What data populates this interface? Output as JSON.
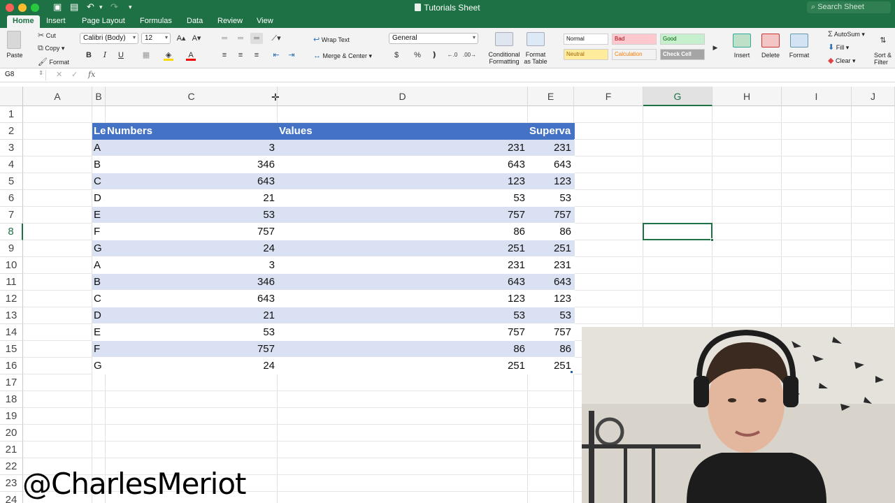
{
  "window": {
    "title": "Tutorials Sheet",
    "search_placeholder": "Search Sheet"
  },
  "ribbon_tabs": [
    {
      "label": "Home",
      "active": true
    },
    {
      "label": "Insert"
    },
    {
      "label": "Page Layout"
    },
    {
      "label": "Formulas"
    },
    {
      "label": "Data"
    },
    {
      "label": "Review"
    },
    {
      "label": "View"
    }
  ],
  "ribbon": {
    "paste": "Paste",
    "cut": "Cut",
    "copy": "Copy",
    "format": "Format",
    "font_name": "Calibri (Body)",
    "font_size": "12",
    "bold": "B",
    "italic": "I",
    "underline": "U",
    "wrap_text": "Wrap Text",
    "merge_center": "Merge & Center",
    "number_format": "General",
    "currency": "$",
    "percent": "%",
    "conditional_formatting": [
      "Conditional",
      "Formatting"
    ],
    "format_as_table": [
      "Format",
      "as Table"
    ],
    "styles": [
      {
        "label": "Normal",
        "bg": "#ffffff",
        "fg": "#111111"
      },
      {
        "label": "Bad",
        "bg": "#ffc7ce",
        "fg": "#9c0006"
      },
      {
        "label": "Good",
        "bg": "#c6efce",
        "fg": "#006100"
      },
      {
        "label": "Neutral",
        "bg": "#ffeb9c",
        "fg": "#9c6500"
      },
      {
        "label": "Calculation",
        "bg": "#f2f2f2",
        "fg": "#fa7d00"
      },
      {
        "label": "Check Cell",
        "bg": "#a5a5a5",
        "fg": "#ffffff"
      }
    ],
    "insert": "Insert",
    "delete": "Delete",
    "format_cells": "Format",
    "autosum": "AutoSum",
    "fill": "Fill",
    "clear": "Clear",
    "sort_filter": [
      "Sort &",
      "Filter"
    ]
  },
  "formula_bar": {
    "name_box": "G8",
    "fx": "fx"
  },
  "sheet": {
    "columns": [
      "A",
      "B",
      "C",
      "D",
      "E",
      "F",
      "G",
      "H",
      "I",
      "J"
    ],
    "selected_column": "G",
    "rows": [
      "1",
      "2",
      "3",
      "4",
      "5",
      "6",
      "7",
      "8",
      "9",
      "10",
      "11",
      "12",
      "13",
      "14",
      "15",
      "16",
      "17",
      "18",
      "19",
      "20",
      "21",
      "22",
      "23",
      "24"
    ],
    "selected_row": "8",
    "table_headers": [
      "Le",
      "Numbers",
      "Values",
      "Superva"
    ],
    "table_rows": [
      [
        "A",
        "3",
        "231",
        "231"
      ],
      [
        "B",
        "346",
        "643",
        "643"
      ],
      [
        "C",
        "643",
        "123",
        "123"
      ],
      [
        "D",
        "21",
        "53",
        "53"
      ],
      [
        "E",
        "53",
        "757",
        "757"
      ],
      [
        "F",
        "757",
        "86",
        "86"
      ],
      [
        "G",
        "24",
        "251",
        "251"
      ],
      [
        "A",
        "3",
        "231",
        "231"
      ],
      [
        "B",
        "346",
        "643",
        "643"
      ],
      [
        "C",
        "643",
        "123",
        "123"
      ],
      [
        "D",
        "21",
        "53",
        "53"
      ],
      [
        "E",
        "53",
        "757",
        "757"
      ],
      [
        "F",
        "757",
        "86",
        "86"
      ],
      [
        "G",
        "24",
        "251",
        "251"
      ]
    ],
    "header_color": "#4472c4",
    "band_color": "#d9e1f2",
    "selection_color": "#1e7145"
  },
  "overlay": {
    "watermark": "@CharlesMeriot"
  }
}
